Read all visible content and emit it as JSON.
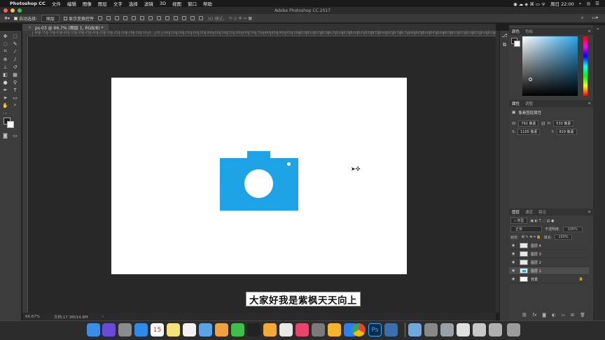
{
  "menubar": {
    "apple": "",
    "app_name": "Photoshop CC",
    "items": [
      "文件",
      "编辑",
      "图像",
      "图层",
      "文字",
      "选择",
      "滤镜",
      "3D",
      "视图",
      "窗口",
      "帮助"
    ],
    "clock": "周日 22:00"
  },
  "window": {
    "title": "Adobe Photoshop CC 2017"
  },
  "options_bar": {
    "auto_select_label": "自动选择:",
    "auto_select_value": "图层",
    "show_transform_label": "显示变换控件",
    "mode_3d_label": "3D 模式:"
  },
  "document_tab": {
    "title": "ps-03 @ 66.7% (图层 1, RGB/8) *",
    "close": "×"
  },
  "ruler_ticks": [
    "-800",
    "-750",
    "-700",
    "-650",
    "-600",
    "-550",
    "-500",
    "-450",
    "-400",
    "-350",
    "-300",
    "-250",
    "-200",
    "-150",
    "-100",
    "-50",
    "0",
    "50",
    "100",
    "150",
    "200",
    "250",
    "300",
    "350",
    "400",
    "450",
    "500",
    "550",
    "600",
    "650",
    "700",
    "750",
    "800",
    "850",
    "900",
    "950",
    "1000",
    "1050",
    "1100",
    "1150",
    "1200",
    "1250",
    "1300",
    "1350",
    "1400",
    "1450",
    "1500",
    "1550",
    "1600",
    "1650",
    "1700",
    "1750",
    "1800",
    "1850",
    "1900",
    "1950",
    "2000",
    "2050",
    "2100",
    "2150",
    "2200",
    "2250",
    "2300",
    "2350",
    "2400",
    "2450"
  ],
  "subtitle": "大家好我是紫枫天天向上",
  "status": {
    "zoom": "66.67%",
    "doc_size": "文档:17.3M/14.8M",
    "arrow": "›"
  },
  "color_panel": {
    "tabs": [
      "颜色",
      "色板"
    ]
  },
  "properties_panel": {
    "tabs": [
      "属性",
      "调整"
    ],
    "header": "像素图层属性",
    "w_label": "W:",
    "w_value": "792 像素",
    "h_label": "H:",
    "h_value": "533 像素",
    "link_icon": "link-icon",
    "x_label": "X:",
    "x_value": "1105 像素",
    "y_label": "Y:",
    "y_value": "819 像素"
  },
  "layers_panel": {
    "tabs": [
      "图层",
      "通道",
      "路径"
    ],
    "filter_label": "类型",
    "blend_mode": "正常",
    "opacity_label": "不透明度:",
    "opacity_value": "100%",
    "lock_label": "锁定:",
    "fill_label": "填充:",
    "fill_value": "100%",
    "layers": [
      {
        "name": "图层 4",
        "active": false
      },
      {
        "name": "图层 3",
        "active": false
      },
      {
        "name": "图层 2",
        "active": false
      },
      {
        "name": "图层 1",
        "active": true
      },
      {
        "name": "背景",
        "active": false
      }
    ]
  },
  "colors": {
    "camera_blue": "#1ea4e6",
    "canvas_bg": "#282828",
    "panel_bg": "#3c3c3c"
  },
  "dock": {
    "icons": [
      "finder-icon",
      "siri-icon",
      "launchpad-icon",
      "safari-icon",
      "calendar-icon",
      "notes-icon",
      "reminders-icon",
      "preview-icon",
      "photos-icon",
      "wechat-icon",
      "qq-icon",
      "pages-icon",
      "textedit-icon",
      "itunes-icon",
      "system-preferences-icon",
      "sketch-icon",
      "app-store-icon",
      "chrome-icon",
      "photoshop-icon",
      "screen-capture-icon",
      "folder-icon",
      "app-window-icon",
      "app-window-icon",
      "app-window-icon",
      "app-window-icon",
      "app-window-icon",
      "trash-icon"
    ],
    "calendar_day": "15",
    "ps_label": "Ps"
  }
}
